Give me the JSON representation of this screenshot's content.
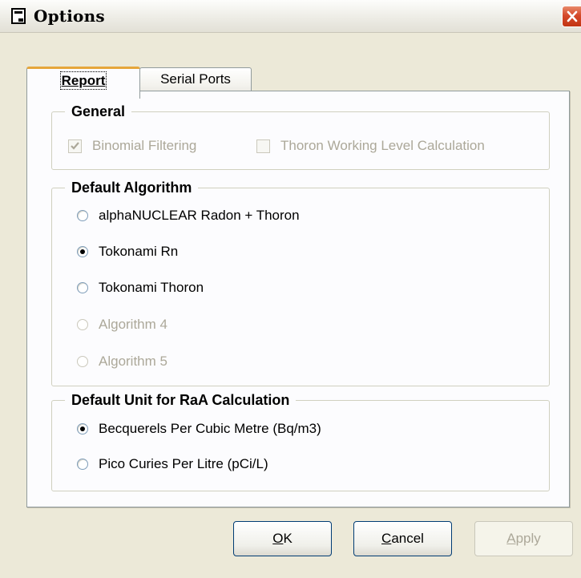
{
  "window": {
    "title": "Options"
  },
  "tabs": [
    {
      "label": "Report",
      "selected": true
    },
    {
      "label": "Serial Ports",
      "selected": false
    }
  ],
  "general": {
    "legend": "General",
    "checkboxes": [
      {
        "label": "Binomial Filtering",
        "checked": true,
        "enabled": false
      },
      {
        "label": "Thoron Working Level Calculation",
        "checked": false,
        "enabled": false
      }
    ]
  },
  "algorithm": {
    "legend": "Default Algorithm",
    "options": [
      {
        "label": "alphaNUCLEAR Radon + Thoron",
        "checked": false,
        "enabled": true
      },
      {
        "label": "Tokonami Rn",
        "checked": true,
        "enabled": true
      },
      {
        "label": "Tokonami Thoron",
        "checked": false,
        "enabled": true
      },
      {
        "label": "Algorithm 4",
        "checked": false,
        "enabled": false
      },
      {
        "label": "Algorithm 5",
        "checked": false,
        "enabled": false
      }
    ]
  },
  "unit": {
    "legend": "Default Unit for RaA Calculation",
    "options": [
      {
        "label": "Becquerels Per Cubic Metre (Bq/m3)",
        "checked": true,
        "enabled": true
      },
      {
        "label": "Pico Curies Per Litre (pCi/L)",
        "checked": false,
        "enabled": true
      }
    ]
  },
  "buttons": {
    "ok": {
      "mnemonic": "O",
      "rest": "K"
    },
    "cancel": {
      "mnemonic": "C",
      "rest": "ancel"
    },
    "apply": {
      "mnemonic": "A",
      "rest": "pply",
      "enabled": false
    }
  },
  "colors": {
    "title_bar_close": "#d5492a",
    "tab_highlight": "#e6a63b",
    "disabled_text": "#aca899"
  },
  "icons": [
    "dialog-app-icon",
    "close-icon",
    "checkmark-icon"
  ]
}
